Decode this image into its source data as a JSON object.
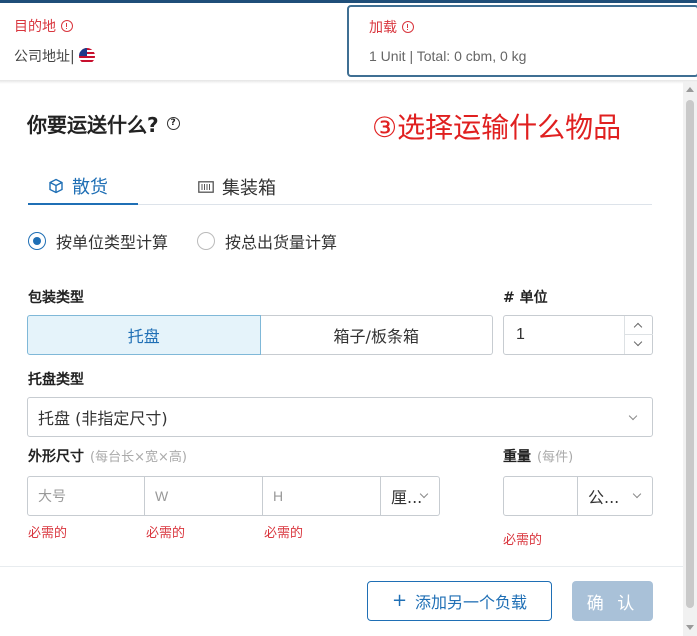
{
  "header": {
    "destination": {
      "label": "目的地",
      "value": "公司地址|",
      "flag_icon": "us-flag-icon"
    },
    "load": {
      "label": "加载",
      "summary": "1 Unit | Total: 0 cbm, 0 kg"
    }
  },
  "dialog": {
    "title": "你要运送什么?",
    "annotation": "③选择运输什么物品",
    "tabs": [
      {
        "label": "散货",
        "icon": "box-icon",
        "active": true
      },
      {
        "label": "集装箱",
        "icon": "container-icon",
        "active": false
      }
    ],
    "calc_modes": [
      {
        "label": "按单位类型计算",
        "selected": true
      },
      {
        "label": "按总出货量计算",
        "selected": false
      }
    ],
    "packaging": {
      "label": "包装类型",
      "options": [
        {
          "label": "托盘",
          "selected": true
        },
        {
          "label": "箱子/板条箱",
          "selected": false
        }
      ]
    },
    "units": {
      "label": "# 单位",
      "value": "1"
    },
    "pallet_type": {
      "label": "托盘类型",
      "value": "托盘 (非指定尺寸)"
    },
    "dimensions": {
      "label": "外形尺寸",
      "hint": "(每台长×宽×高)",
      "length_placeholder": "大号",
      "width_placeholder": "W",
      "height_placeholder": "H",
      "unit": "厘...",
      "required": "必需的"
    },
    "weight": {
      "label": "重量",
      "hint": "(每件)",
      "value": "",
      "unit": "公...",
      "required": "必需的"
    },
    "footer": {
      "add_label": "添加另一个负载",
      "confirm_label": "确 认"
    }
  },
  "colors": {
    "accent": "#1f6fb5",
    "error": "#d9363e",
    "annotation": "#e02020",
    "confirm_disabled": "#a9c1d8"
  }
}
